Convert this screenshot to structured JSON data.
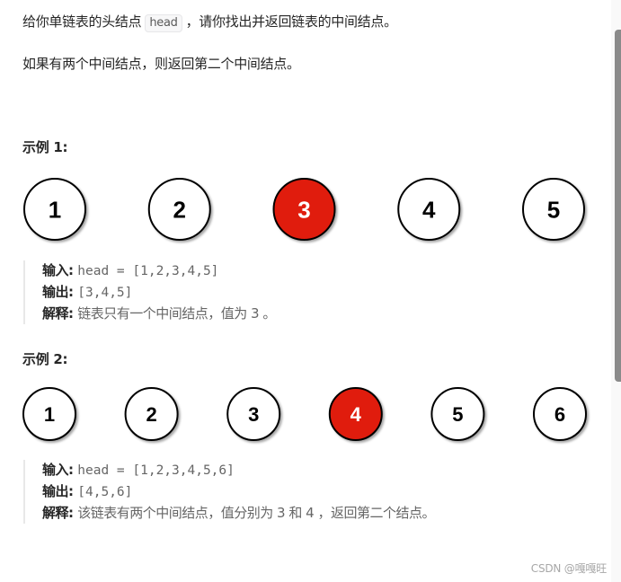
{
  "problem": {
    "line1_before": "给你单链表的头结点",
    "line1_code": "head",
    "line1_after": "，请你找出并返回链表的中间结点。",
    "line2": "如果有两个中间结点，则返回第二个中间结点。"
  },
  "examples": [
    {
      "title": "示例 1:",
      "nodes": [
        "1",
        "2",
        "3",
        "4",
        "5"
      ],
      "highlight_index": 2,
      "input_label": "输入:",
      "input_value": "head = [1,2,3,4,5]",
      "output_label": "输出:",
      "output_value": "[3,4,5]",
      "explain_label": "解释:",
      "explain_value": "链表只有一个中间结点，值为 3 。"
    },
    {
      "title": "示例 2:",
      "nodes": [
        "1",
        "2",
        "3",
        "4",
        "5",
        "6"
      ],
      "highlight_index": 3,
      "input_label": "输入:",
      "input_value": "head = [1,2,3,4,5,6]",
      "output_label": "输出:",
      "output_value": "[4,5,6]",
      "explain_label": "解释:",
      "explain_value": "该链表有两个中间结点，值分别为 3 和 4 ，返回第二个结点。"
    }
  ],
  "colors": {
    "highlight_fill": "#e01a0a",
    "node_fill": "#ffffff",
    "node_stroke": "#000000"
  },
  "watermark": "CSDN @嘎嘎旺"
}
